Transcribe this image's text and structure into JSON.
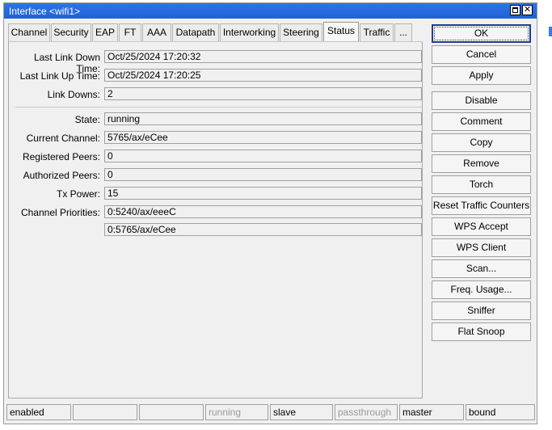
{
  "window": {
    "title": "Interface <wifi1>"
  },
  "tabs": [
    {
      "label": "Channel"
    },
    {
      "label": "Security"
    },
    {
      "label": "EAP"
    },
    {
      "label": "FT"
    },
    {
      "label": "AAA"
    },
    {
      "label": "Datapath"
    },
    {
      "label": "Interworking"
    },
    {
      "label": "Steering"
    },
    {
      "label": "Status"
    },
    {
      "label": "Traffic"
    },
    {
      "label": "..."
    }
  ],
  "active_tab": "Status",
  "status": {
    "last_link_down_time": {
      "label": "Last Link Down Time:",
      "value": "Oct/25/2024 17:20:32"
    },
    "last_link_up_time": {
      "label": "Last Link Up Time:",
      "value": "Oct/25/2024 17:20:25"
    },
    "link_downs": {
      "label": "Link Downs:",
      "value": "2"
    },
    "state": {
      "label": "State:",
      "value": "running"
    },
    "current_channel": {
      "label": "Current Channel:",
      "value": "5765/ax/eCee"
    },
    "registered_peers": {
      "label": "Registered Peers:",
      "value": "0"
    },
    "authorized_peers": {
      "label": "Authorized Peers:",
      "value": "0"
    },
    "tx_power": {
      "label": "Tx Power:",
      "value": "15"
    },
    "channel_priorities": {
      "label": "Channel Priorities:",
      "values": [
        "0:5240/ax/eeeC",
        "0:5765/ax/eCee"
      ]
    }
  },
  "buttons": {
    "ok": "OK",
    "cancel": "Cancel",
    "apply": "Apply",
    "disable": "Disable",
    "comment": "Comment",
    "copy": "Copy",
    "remove": "Remove",
    "torch": "Torch",
    "reset_traffic_counters": "Reset Traffic Counters",
    "wps_accept": "WPS Accept",
    "wps_client": "WPS Client",
    "scan": "Scan...",
    "freq_usage": "Freq. Usage...",
    "sniffer": "Sniffer",
    "flat_snoop": "Flat Snoop"
  },
  "statusbar": [
    "enabled",
    "",
    "",
    "running",
    "slave",
    "passthrough",
    "master",
    "bound"
  ],
  "colors": {
    "titlebar": "#1e63d6",
    "panel": "#f0f0f0",
    "ok_border": "#1c3f8e",
    "dim_text": "#9a9a9a"
  }
}
